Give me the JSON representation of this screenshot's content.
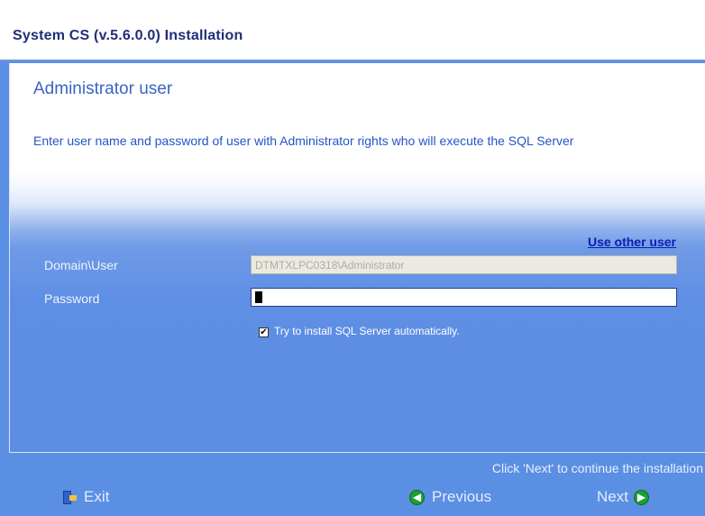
{
  "window": {
    "title": "System CS (v.5.6.0.0) Installation"
  },
  "page": {
    "section_title": "Administrator user",
    "instruction": "Enter user name and password of user with Administrator rights who will execute the SQL Server",
    "use_other_user": "Use other user"
  },
  "form": {
    "domain_user_label": "Domain\\User",
    "domain_user_value": "DTMTXLPC0318\\Administrator",
    "password_label": "Password",
    "password_value": "",
    "auto_install_label": "Try to install SQL Server automatically.",
    "auto_install_checked": true
  },
  "footer": {
    "status": "Click 'Next' to continue the installation",
    "exit": "Exit",
    "previous": "Previous",
    "next": "Next"
  },
  "icons": {
    "exit": "exit-door-icon",
    "previous": "green-left-arrow-icon",
    "next": "green-right-arrow-icon"
  }
}
